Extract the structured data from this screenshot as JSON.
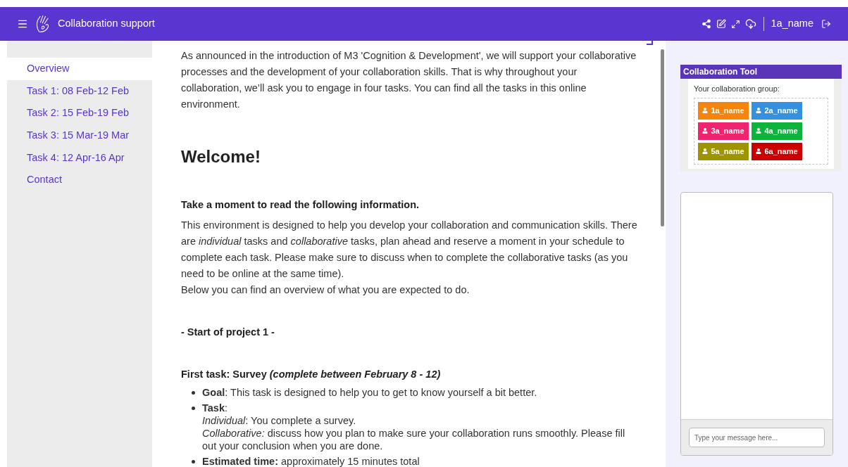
{
  "header": {
    "title": "Collaboration support",
    "user": "1a_name"
  },
  "sidebar": {
    "items": [
      {
        "label": "Overview",
        "selected": true
      },
      {
        "label": "Task 1: 08 Feb-12 Feb",
        "selected": false
      },
      {
        "label": "Task 2: 15 Feb-19 Feb",
        "selected": false
      },
      {
        "label": "Task 3: 15 Mar-19 Mar",
        "selected": false
      },
      {
        "label": "Task 4: 12 Apr-16 Apr",
        "selected": false
      },
      {
        "label": "Contact",
        "selected": false
      }
    ]
  },
  "content": {
    "intro": "As announced in the introduction of M3 'Cognition & Development', we will support your collaborative processes and the development of your collaboration skills. That is why throughout your collaboration, we’ll ask you to engage in four tasks. You can find all the tasks in this online environment.",
    "heading": "Welcome!",
    "subheading": "Take a moment to read the following information.",
    "paragraphs": [
      "This environment is designed to help you develop your collaboration and communication skills. There are *individual* tasks and *collaborative* tasks, plan ahead and reserve a moment in your schedule to complete each task. Please make sure to discuss when to complete the collaborative tasks (as you need to be online at the same time).",
      "Below you can find an overview of what you are expected to do."
    ],
    "section": "- Start of project 1 -",
    "task_title": "First task: Survey *(complete between February 8 - 12)*",
    "bullets": [
      {
        "lines": [
          "**Goal**: This task is designed to help you to get to know yourself a bit better."
        ]
      },
      {
        "lines": [
          "**Task**:",
          "*Individual*: You complete a survey.",
          "*Collaborative:* discuss how you plan to make sure your collaboration runs smoothly. Please fill out your conclusion when you are done."
        ]
      },
      {
        "lines": [
          "**Estimated time:** approximately 15 minutes total"
        ]
      }
    ]
  },
  "collaboration_tool": {
    "title": "Collaboration Tool",
    "group_label": "Your collaboration group:",
    "members": [
      {
        "name": "1a_name",
        "color": "#f5840c"
      },
      {
        "name": "2a_name",
        "color": "#3590e0"
      },
      {
        "name": "3a_name",
        "color": "#f0246e"
      },
      {
        "name": "4a_name",
        "color": "#0db33c"
      },
      {
        "name": "5a_name",
        "color": "#9e9400"
      },
      {
        "name": "6a_name",
        "color": "#cc0000"
      }
    ]
  },
  "chat": {
    "placeholder": "Type your message here..."
  }
}
